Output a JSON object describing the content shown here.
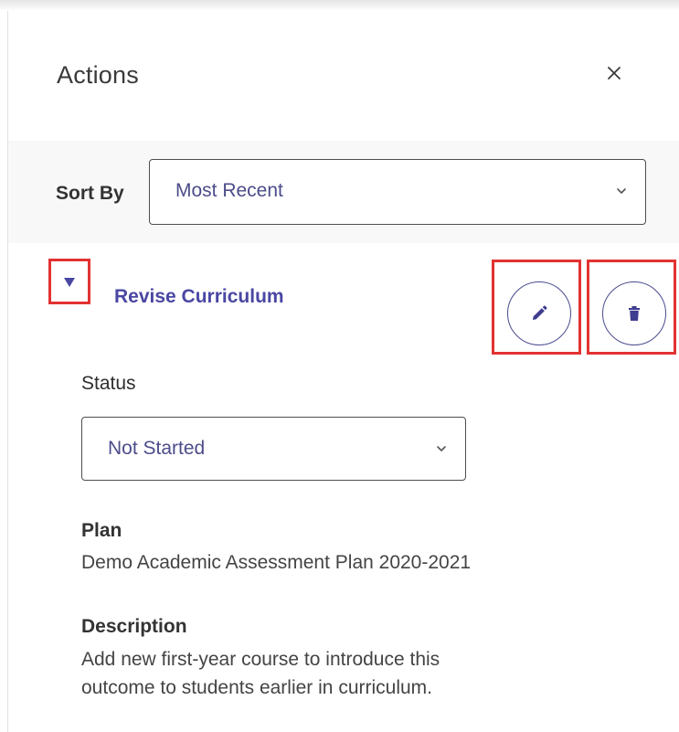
{
  "header": {
    "title": "Actions",
    "close_label": "×"
  },
  "sort": {
    "label": "Sort By",
    "selected": "Most Recent"
  },
  "action_item": {
    "title": "Revise Curriculum",
    "expanded": true,
    "status": {
      "label": "Status",
      "selected": "Not Started"
    },
    "plan": {
      "label": "Plan",
      "value": "Demo Academic Assessment Plan 2020-2021"
    },
    "description": {
      "label": "Description",
      "lines": [
        "Add new first-year course to introduce this",
        "outcome to students earlier in curriculum."
      ]
    }
  },
  "icons": {
    "close": "close-icon",
    "chevron": "chevron-down-icon",
    "toggle": "caret-down-icon",
    "edit": "pencil-icon",
    "delete": "trash-icon"
  },
  "colors": {
    "accent": "#4a47a3",
    "highlight": "#e23232",
    "select_text": "#4c4c8a",
    "band_background": "#f8f8f8"
  }
}
